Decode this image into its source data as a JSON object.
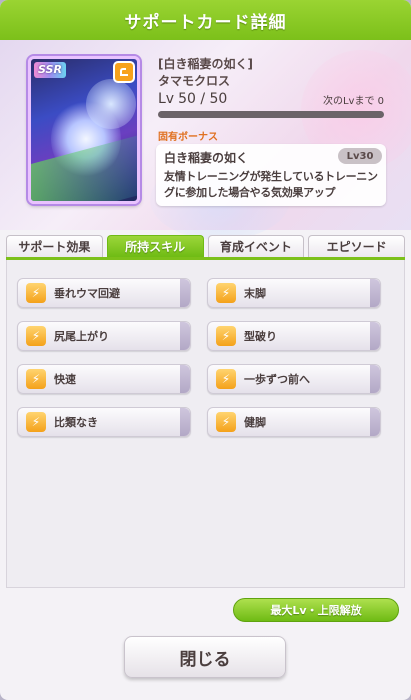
{
  "window": {
    "title": "サポートカード詳細"
  },
  "card": {
    "rarity": "SSR",
    "type_icon": "power-type-icon",
    "card_name": "[白き稲妻の如く]",
    "character_name": "タマモクロス",
    "level_label": "Lv",
    "level": "50 / 50",
    "next_level": "次のLvまで 0",
    "exp_progress": 1.0
  },
  "unique_bonus": {
    "label": "固有ボーナス",
    "name": "白き稲妻の如く",
    "level": "Lv30",
    "description": "友情トレーニングが発生しているトレーニングに参加した場合やる気効果アップ"
  },
  "tabs": [
    {
      "label": "サポート効果",
      "active": false
    },
    {
      "label": "所持スキル",
      "active": true
    },
    {
      "label": "育成イベント",
      "active": false
    },
    {
      "label": "エピソード",
      "active": false
    }
  ],
  "skills": [
    {
      "name": "垂れウマ回避",
      "icon": "running-icon"
    },
    {
      "name": "末脚",
      "icon": "running-icon"
    },
    {
      "name": "尻尾上がり",
      "icon": "running-icon"
    },
    {
      "name": "型破り",
      "icon": "running-icon"
    },
    {
      "name": "快速",
      "icon": "running-icon"
    },
    {
      "name": "一歩ずつ前へ",
      "icon": "running-icon"
    },
    {
      "name": "比類なき",
      "icon": "running-icon"
    },
    {
      "name": "健脚",
      "icon": "running-icon"
    }
  ],
  "buttons": {
    "max_level": "最大Lv・上限解放",
    "close": "閉じる"
  },
  "colors": {
    "accent_green": "#7cc01a",
    "skill_icon_orange": "#f4a11a",
    "bonus_label": "#e07020"
  }
}
